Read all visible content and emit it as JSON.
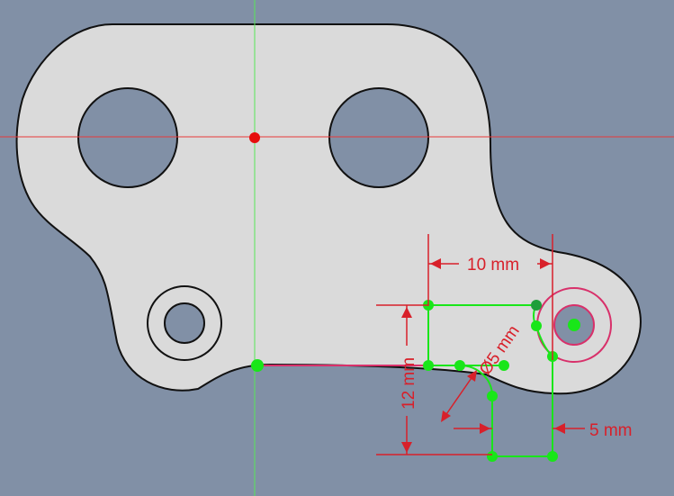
{
  "viewport": {
    "background": "#8190a6",
    "part_fill": "#dadada",
    "outline_color": "#111111",
    "sketch_color": "#19e619",
    "axis_h_color": "#e83a3a",
    "axis_v_color": "#57e657",
    "dimension_color": "#d8202a",
    "selection_color": "#d8306a"
  },
  "dimensions": {
    "width_top": "10 mm",
    "height_left": "12 mm",
    "diameter": "Ø5 mm",
    "offset_right": "5 mm"
  }
}
